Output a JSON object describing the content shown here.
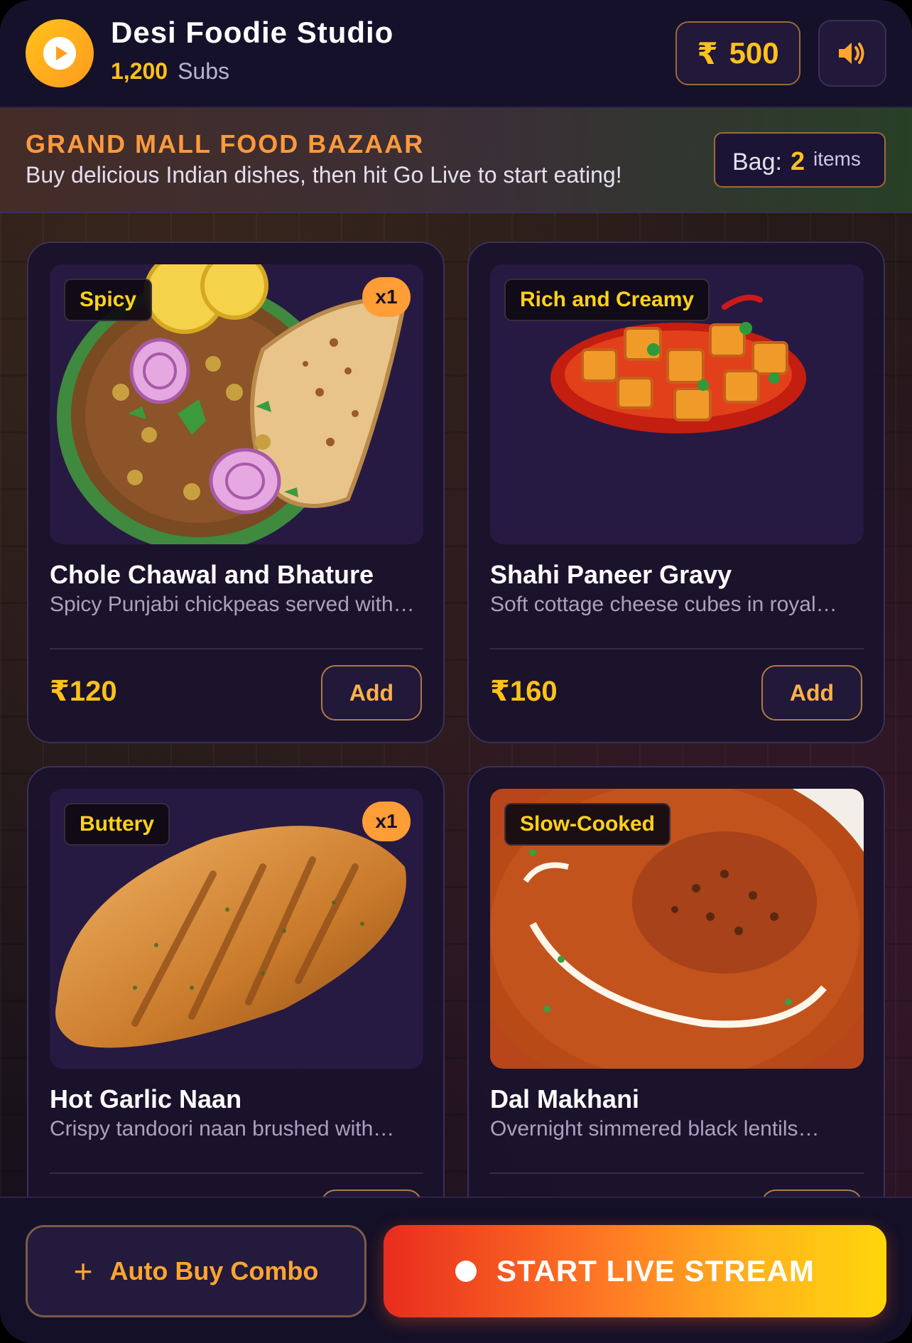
{
  "header": {
    "channel_name": "Desi Foodie Studio",
    "subs_count": "1,200",
    "subs_label": "Subs",
    "currency_symbol": "₹",
    "coins": "500"
  },
  "banner": {
    "title": "GRAND MALL FOOD BAZAAR",
    "subtitle": "Buy delicious Indian dishes, then hit Go Live to start eating!",
    "bag_label": "Bag:",
    "bag_count": "2",
    "bag_items_label": "items"
  },
  "dishes": [
    {
      "tag": "Spicy",
      "qty": "x1",
      "name": "Chole Chawal and Bhature",
      "desc": "Spicy Punjabi chickpeas served with…",
      "price": "₹120",
      "add_label": "Add"
    },
    {
      "tag": "Rich and Creamy",
      "qty": "",
      "name": "Shahi Paneer Gravy",
      "desc": "Soft cottage cheese cubes in royal…",
      "price": "₹160",
      "add_label": "Add"
    },
    {
      "tag": "Buttery",
      "qty": "x1",
      "name": "Hot Garlic Naan",
      "desc": "Crispy tandoori naan brushed with…",
      "price": "",
      "add_label": ""
    },
    {
      "tag": "Slow-Cooked",
      "qty": "",
      "name": "Dal Makhani",
      "desc": "Overnight simmered black lentils…",
      "price": "",
      "add_label": ""
    }
  ],
  "footer": {
    "combo_label": "Auto Buy Combo",
    "live_label": "START LIVE STREAM"
  },
  "colors": {
    "accent_gold": "#ffc21a",
    "accent_orange": "#ff9a3c",
    "live_gradient_start": "#e82d1e",
    "live_gradient_end": "#ffd60a"
  },
  "icons": [
    "play-icon",
    "rupee-icon",
    "speaker-icon",
    "plus-icon",
    "record-dot-icon"
  ]
}
